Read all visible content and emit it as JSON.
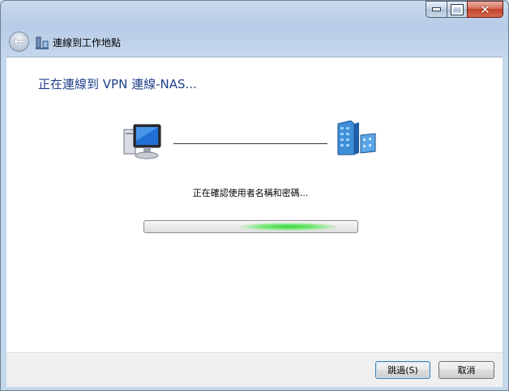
{
  "titlebar": {
    "minimize_icon": "minimize-icon",
    "maximize_icon": "maximize-icon",
    "close_icon": "close-icon",
    "close_glyph": "✕"
  },
  "nav": {
    "back_icon": "back-arrow-icon",
    "back_glyph": "←",
    "app_icon": "network-connection-icon",
    "title": "連線到工作地點"
  },
  "main": {
    "heading": "正在連線到 VPN 連線-NAS...",
    "computer_icon": "computer-icon",
    "server_icon": "server-icon",
    "status_text": "正在確認使用者名稱和密碼...",
    "progress_state": "indeterminate",
    "progress_color": "#3bd43b"
  },
  "footer": {
    "skip_label": "跳過(S)",
    "cancel_label": "取消"
  },
  "colors": {
    "heading": "#1e3f8b",
    "frame": "#c9daee",
    "close_button": "#c2412b"
  }
}
